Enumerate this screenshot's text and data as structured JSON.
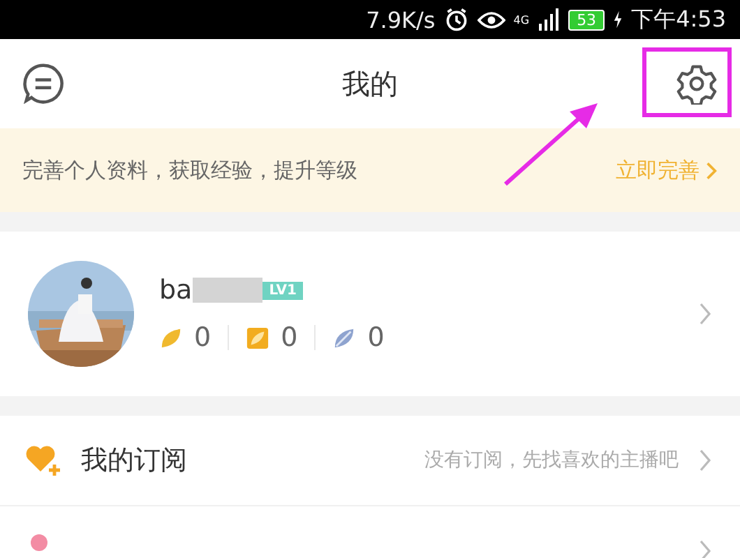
{
  "status_bar": {
    "speed": "7.9K/s",
    "network": "4G",
    "battery": "53",
    "time": "下午4:53"
  },
  "header": {
    "title": "我的"
  },
  "banner": {
    "text": "完善个人资料，获取经验，提升等级",
    "action": "立即完善"
  },
  "profile": {
    "username": "ba",
    "level_badge": "LV1",
    "stats": [
      {
        "kind": "leaf",
        "value": "0"
      },
      {
        "kind": "ticket",
        "value": "0"
      },
      {
        "kind": "feather",
        "value": "0"
      }
    ]
  },
  "menu": [
    {
      "kind": "heart",
      "label": "我的订阅",
      "hint": "没有订阅，先找喜欢的主播吧"
    },
    {
      "kind": "dot"
    }
  ]
}
